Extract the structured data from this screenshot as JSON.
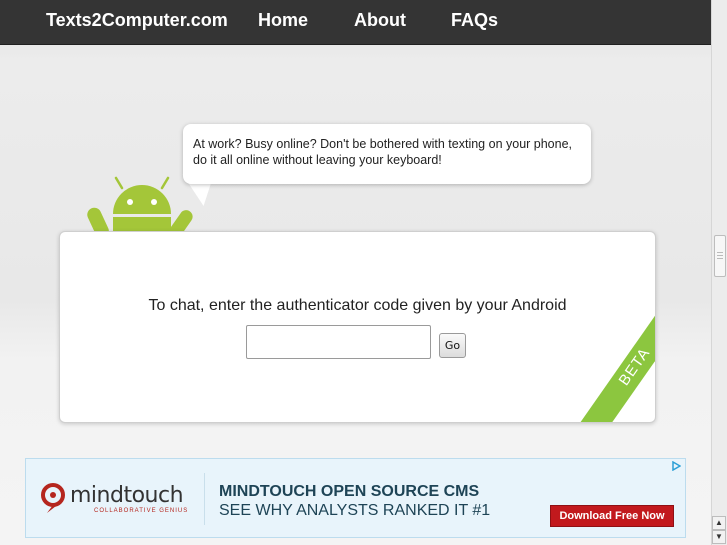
{
  "header": {
    "brand": "Texts2Computer.com",
    "nav": [
      {
        "label": "Home"
      },
      {
        "label": "About"
      },
      {
        "label": "FAQs"
      }
    ]
  },
  "bubble": {
    "text": "At work? Busy online? Don't be bothered with texting on your phone, do it all online without leaving your keyboard!"
  },
  "auth": {
    "prompt": "To chat, enter the authenticator code given by your Android",
    "code_value": "",
    "go_label": "Go",
    "badge": "BETA"
  },
  "ad": {
    "logo_text": "mindtouch",
    "tagline": "COLLABORATIVE GENIUS",
    "headline": "MINDTOUCH OPEN SOURCE CMS",
    "subheadline": "SEE WHY ANALYSTS RANKED IT #1",
    "cta": "Download Free Now",
    "choices_icon": "ad-choices-icon"
  },
  "colors": {
    "topbar": "#343434",
    "android_green": "#a4c639",
    "beta_green": "#8cc63f",
    "cta_red": "#c2191d",
    "ad_bg": "#e8f4fb"
  }
}
